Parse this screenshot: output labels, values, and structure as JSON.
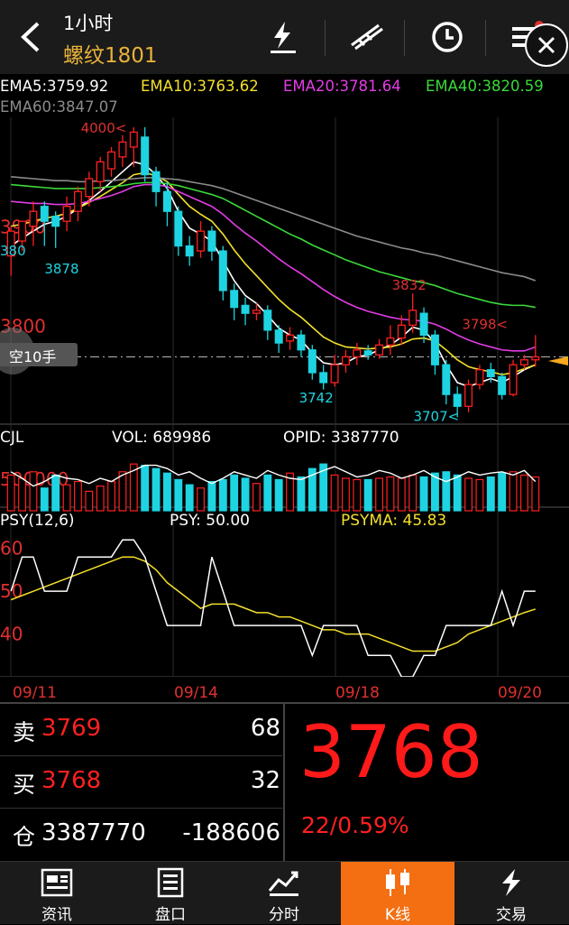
{
  "header": {
    "period": "1小时",
    "symbol": "螺纹1801"
  },
  "ema": {
    "ema5": "EMA5:3759.92",
    "ema10": "EMA10:3763.62",
    "ema20": "EMA20:3781.64",
    "ema40": "EMA40:3820.59",
    "ema60": "EMA60:3847.07"
  },
  "chart_data": {
    "type": "candlestick",
    "price_labels": [
      "4000",
      "3900",
      "3800"
    ],
    "annotations": [
      "4000<",
      "3878",
      "3832",
      "3742",
      "3798<",
      "3707<",
      "380"
    ],
    "position_badge": "空10手",
    "current_price_line": 3768,
    "candles": [
      [
        3870,
        3895,
        3850,
        3900
      ],
      [
        3885,
        3905,
        3875,
        3895
      ],
      [
        3900,
        3915,
        3880,
        3925
      ],
      [
        3920,
        3905,
        3880,
        3925
      ],
      [
        3910,
        3900,
        3878,
        3915
      ],
      [
        3905,
        3920,
        3895,
        3930
      ],
      [
        3915,
        3935,
        3905,
        3940
      ],
      [
        3930,
        3948,
        3920,
        3955
      ],
      [
        3945,
        3965,
        3935,
        3970
      ],
      [
        3958,
        3975,
        3950,
        3980
      ],
      [
        3970,
        3985,
        3960,
        3992
      ],
      [
        3980,
        3995,
        3960,
        4000
      ],
      [
        3990,
        3952,
        3945,
        4000
      ],
      [
        3955,
        3935,
        3920,
        3960
      ],
      [
        3935,
        3915,
        3900,
        3945
      ],
      [
        3915,
        3880,
        3870,
        3920
      ],
      [
        3880,
        3870,
        3860,
        3890
      ],
      [
        3875,
        3895,
        3868,
        3905
      ],
      [
        3895,
        3875,
        3865,
        3900
      ],
      [
        3875,
        3835,
        3825,
        3880
      ],
      [
        3835,
        3818,
        3805,
        3842
      ],
      [
        3820,
        3812,
        3800,
        3828
      ],
      [
        3812,
        3815,
        3805,
        3822
      ],
      [
        3815,
        3795,
        3785,
        3820
      ],
      [
        3795,
        3782,
        3772,
        3800
      ],
      [
        3784,
        3790,
        3775,
        3798
      ],
      [
        3790,
        3775,
        3768,
        3795
      ],
      [
        3775,
        3752,
        3745,
        3780
      ],
      [
        3752,
        3742,
        3735,
        3760
      ],
      [
        3742,
        3760,
        3738,
        3770
      ],
      [
        3760,
        3768,
        3752,
        3775
      ],
      [
        3768,
        3775,
        3760,
        3782
      ],
      [
        3774,
        3770,
        3765,
        3780
      ],
      [
        3770,
        3780,
        3766,
        3786
      ],
      [
        3780,
        3787,
        3770,
        3800
      ],
      [
        3787,
        3800,
        3780,
        3810
      ],
      [
        3800,
        3815,
        3792,
        3832
      ],
      [
        3812,
        3790,
        3782,
        3818
      ],
      [
        3790,
        3760,
        3750,
        3795
      ],
      [
        3760,
        3730,
        3720,
        3765
      ],
      [
        3730,
        3718,
        3707,
        3738
      ],
      [
        3718,
        3740,
        3712,
        3745
      ],
      [
        3740,
        3755,
        3735,
        3760
      ],
      [
        3755,
        3748,
        3742,
        3762
      ],
      [
        3748,
        3730,
        3725,
        3752
      ],
      [
        3730,
        3760,
        3728,
        3765
      ],
      [
        3760,
        3765,
        3755,
        3770
      ],
      [
        3765,
        3768,
        3758,
        3790
      ]
    ],
    "ema_series": {
      "EMA5": [
        3880,
        3888,
        3895,
        3902,
        3905,
        3910,
        3918,
        3926,
        3935,
        3945,
        3955,
        3965,
        3962,
        3952,
        3938,
        3915,
        3898,
        3892,
        3885,
        3865,
        3845,
        3830,
        3822,
        3810,
        3797,
        3790,
        3785,
        3772,
        3762,
        3760,
        3762,
        3768,
        3770,
        3775,
        3780,
        3788,
        3798,
        3795,
        3782,
        3760,
        3742,
        3738,
        3742,
        3746,
        3742,
        3748,
        3755,
        3760
      ],
      "EMA10": [
        3900,
        3902,
        3905,
        3908,
        3910,
        3913,
        3918,
        3924,
        3930,
        3937,
        3944,
        3952,
        3954,
        3951,
        3945,
        3932,
        3920,
        3912,
        3905,
        3892,
        3876,
        3862,
        3850,
        3838,
        3826,
        3816,
        3808,
        3798,
        3788,
        3782,
        3778,
        3777,
        3776,
        3777,
        3778,
        3781,
        3786,
        3787,
        3784,
        3775,
        3765,
        3758,
        3755,
        3753,
        3750,
        3752,
        3756,
        3760
      ],
      "EMA20": [
        3925,
        3924,
        3923,
        3923,
        3922,
        3922,
        3923,
        3925,
        3928,
        3931,
        3935,
        3940,
        3942,
        3942,
        3940,
        3935,
        3930,
        3925,
        3920,
        3912,
        3902,
        3893,
        3885,
        3876,
        3867,
        3859,
        3852,
        3844,
        3836,
        3829,
        3823,
        3818,
        3814,
        3811,
        3808,
        3806,
        3805,
        3804,
        3801,
        3796,
        3790,
        3785,
        3781,
        3778,
        3775,
        3774,
        3774,
        3778
      ],
      "EMA40": [
        3942,
        3941,
        3940,
        3939,
        3938,
        3938,
        3938,
        3938,
        3939,
        3940,
        3941,
        3943,
        3944,
        3944,
        3943,
        3941,
        3938,
        3935,
        3932,
        3928,
        3922,
        3916,
        3910,
        3904,
        3898,
        3892,
        3887,
        3881,
        3876,
        3871,
        3866,
        3862,
        3858,
        3854,
        3851,
        3848,
        3845,
        3843,
        3840,
        3836,
        3832,
        3829,
        3826,
        3823,
        3821,
        3820,
        3820,
        3818
      ],
      "EMA60": [
        3950,
        3949,
        3948,
        3947,
        3946,
        3946,
        3945,
        3945,
        3946,
        3946,
        3947,
        3948,
        3949,
        3949,
        3948,
        3947,
        3945,
        3943,
        3941,
        3938,
        3934,
        3930,
        3926,
        3922,
        3918,
        3914,
        3910,
        3906,
        3902,
        3898,
        3894,
        3890,
        3887,
        3884,
        3881,
        3878,
        3876,
        3873,
        3871,
        3868,
        3865,
        3862,
        3859,
        3856,
        3853,
        3851,
        3849,
        3845
      ]
    },
    "volume_panel": {
      "title": "CJL",
      "vol_label": "VOL: 689986",
      "opid_label": "OPID: 3387770",
      "axis_label": "500000",
      "volume": [
        0.55,
        0.5,
        0.6,
        0.35,
        0.55,
        0.4,
        0.45,
        0.3,
        0.38,
        0.45,
        0.6,
        0.72,
        0.7,
        0.65,
        0.58,
        0.48,
        0.4,
        0.35,
        0.45,
        0.48,
        0.55,
        0.5,
        0.42,
        0.55,
        0.48,
        0.58,
        0.52,
        0.65,
        0.72,
        0.55,
        0.5,
        0.48,
        0.48,
        0.5,
        0.52,
        0.5,
        0.55,
        0.52,
        0.58,
        0.6,
        0.55,
        0.5,
        0.48,
        0.52,
        0.58,
        0.6,
        0.55,
        0.52
      ],
      "opid": [
        0.6,
        0.5,
        0.38,
        0.45,
        0.55,
        0.5,
        0.48,
        0.42,
        0.5,
        0.45,
        0.55,
        0.62,
        0.7,
        0.7,
        0.65,
        0.55,
        0.6,
        0.5,
        0.42,
        0.5,
        0.6,
        0.55,
        0.5,
        0.62,
        0.55,
        0.5,
        0.48,
        0.55,
        0.62,
        0.68,
        0.6,
        0.52,
        0.55,
        0.62,
        0.58,
        0.5,
        0.55,
        0.62,
        0.52,
        0.45,
        0.52,
        0.6,
        0.55,
        0.58,
        0.6,
        0.55,
        0.62,
        0.45
      ]
    },
    "psy_panel": {
      "title": "PSY(12,6)",
      "psy_label": "PSY: 50.00",
      "psyma_label": "PSYMA: 45.83",
      "ticks": [
        "60",
        "50",
        "40"
      ],
      "ylim": [
        30,
        65
      ],
      "psy": [
        50,
        58,
        58,
        50,
        50,
        50,
        58,
        58,
        58,
        58,
        62,
        62,
        58,
        50,
        42,
        42,
        42,
        42,
        58,
        50,
        42,
        42,
        42,
        42,
        42,
        42,
        42,
        35,
        42,
        42,
        42,
        42,
        35,
        35,
        35,
        30,
        30,
        35,
        35,
        42,
        42,
        42,
        42,
        42,
        50,
        42,
        50,
        50
      ],
      "psyma": [
        48,
        49,
        50,
        51,
        52,
        53,
        54,
        55,
        56,
        57,
        58,
        58,
        57,
        55,
        52,
        50,
        48,
        46,
        47,
        47,
        47,
        46,
        45,
        45,
        44,
        44,
        43,
        42,
        41,
        41,
        40,
        40,
        40,
        39,
        38,
        37,
        36,
        36,
        36,
        37,
        38,
        40,
        41,
        42,
        43,
        44,
        45,
        45.83
      ]
    },
    "dates": [
      "09/11",
      "09/14",
      "09/18",
      "09/20"
    ]
  },
  "quote": {
    "sell_label": "卖",
    "sell_price": "3769",
    "sell_vol": "68",
    "buy_label": "买",
    "buy_price": "3768",
    "buy_vol": "32",
    "oi_label": "仓",
    "oi_value": "3387770",
    "oi_change": "-188606",
    "last": "3768",
    "change": "22/0.59%"
  },
  "tabs": [
    {
      "label": "资讯",
      "icon": "news-icon"
    },
    {
      "label": "盘口",
      "icon": "orderbook-icon"
    },
    {
      "label": "分时",
      "icon": "timeshare-icon"
    },
    {
      "label": "K线",
      "icon": "kline-icon"
    },
    {
      "label": "交易",
      "icon": "trade-icon"
    }
  ],
  "colors": {
    "up": "#ff2020",
    "down": "#1ed4e2",
    "ema5": "#ffffff",
    "ema10": "#f3e02a",
    "ema20": "#e23de5",
    "ema40": "#3ad93a",
    "ema60": "#8b8b8b",
    "accent": "#f36f12"
  }
}
